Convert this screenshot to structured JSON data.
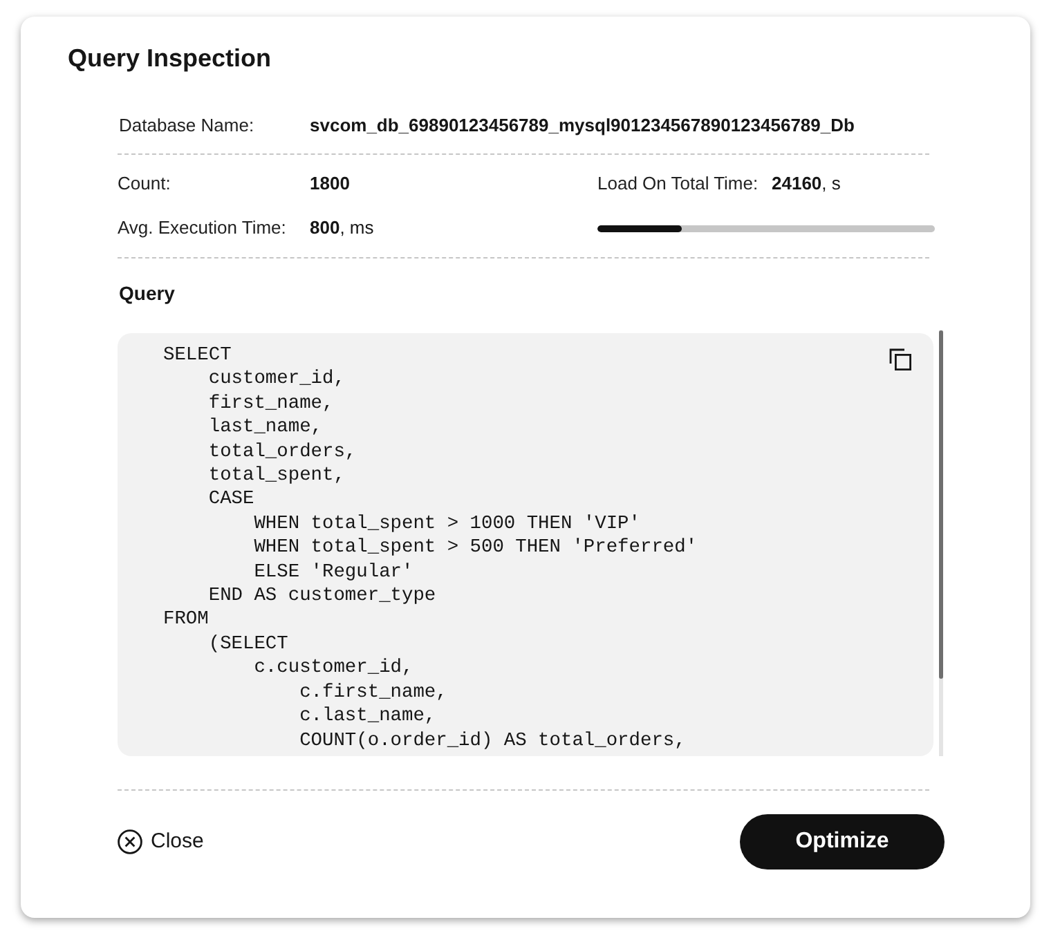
{
  "dialog": {
    "title": "Query Inspection"
  },
  "database": {
    "label": "Database Name:",
    "value": "svcom_db_69890123456789_mysql901234567890123456789_Db"
  },
  "stats": [
    {
      "label": "Count:",
      "value": "1800"
    },
    {
      "label": "Load On Total Time:",
      "value": "24160",
      "unit": ", s"
    },
    {
      "label": "Avg. Execution Time:",
      "value": "800",
      "unit": ", ms"
    }
  ],
  "load_bar": {
    "level": 0.25
  },
  "query": {
    "heading": "Query",
    "code": "SELECT\n    customer_id,\n    first_name,\n    last_name,\n    total_orders,\n    total_spent,\n    CASE\n        WHEN total_spent > 1000 THEN 'VIP'\n        WHEN total_spent > 500 THEN 'Preferred'\n        ELSE 'Regular'\n    END AS customer_type\nFROM\n    (SELECT\n        c.customer_id,\n            c.first_name,\n            c.last_name,\n            COUNT(o.order_id) AS total_orders,"
  },
  "footer": {
    "close": "Close",
    "primary": "Optimize"
  }
}
